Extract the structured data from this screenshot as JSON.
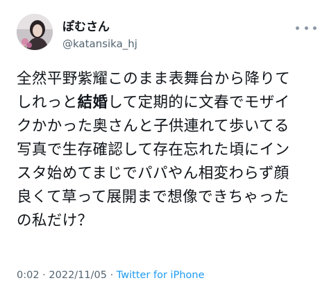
{
  "tweet": {
    "display_name": "ぽむさん",
    "handle": "@katansika_hj",
    "text_lines": [
      {
        "before": "全然平野紫耀このまま表舞台から降りて",
        "bold": "",
        "after": ""
      },
      {
        "before": "しれっと",
        "bold": "結婚",
        "after": "して定期的に文春でモザイ"
      },
      {
        "before": "クかかった奥さんと子供連れて歩いてる",
        "bold": "",
        "after": ""
      },
      {
        "before": "写真で生存確認して存在忘れた頃にイン",
        "bold": "",
        "after": ""
      },
      {
        "before": "スタ始めてまじでパパやん相変わらず顔",
        "bold": "",
        "after": ""
      },
      {
        "before": "良くて草って展開まで想像できちゃった",
        "bold": "",
        "after": ""
      },
      {
        "before": "の私だけ？",
        "bold": "",
        "after": ""
      }
    ],
    "time": "0:02",
    "separator1": "·",
    "date": "2022/11/05",
    "separator2": "·",
    "source": "Twitter for iPhone"
  },
  "icons": {
    "more": "more-horizontal-icon"
  },
  "colors": {
    "text": "#0f1419",
    "secondary": "#536471",
    "link": "#1d9bf0"
  }
}
